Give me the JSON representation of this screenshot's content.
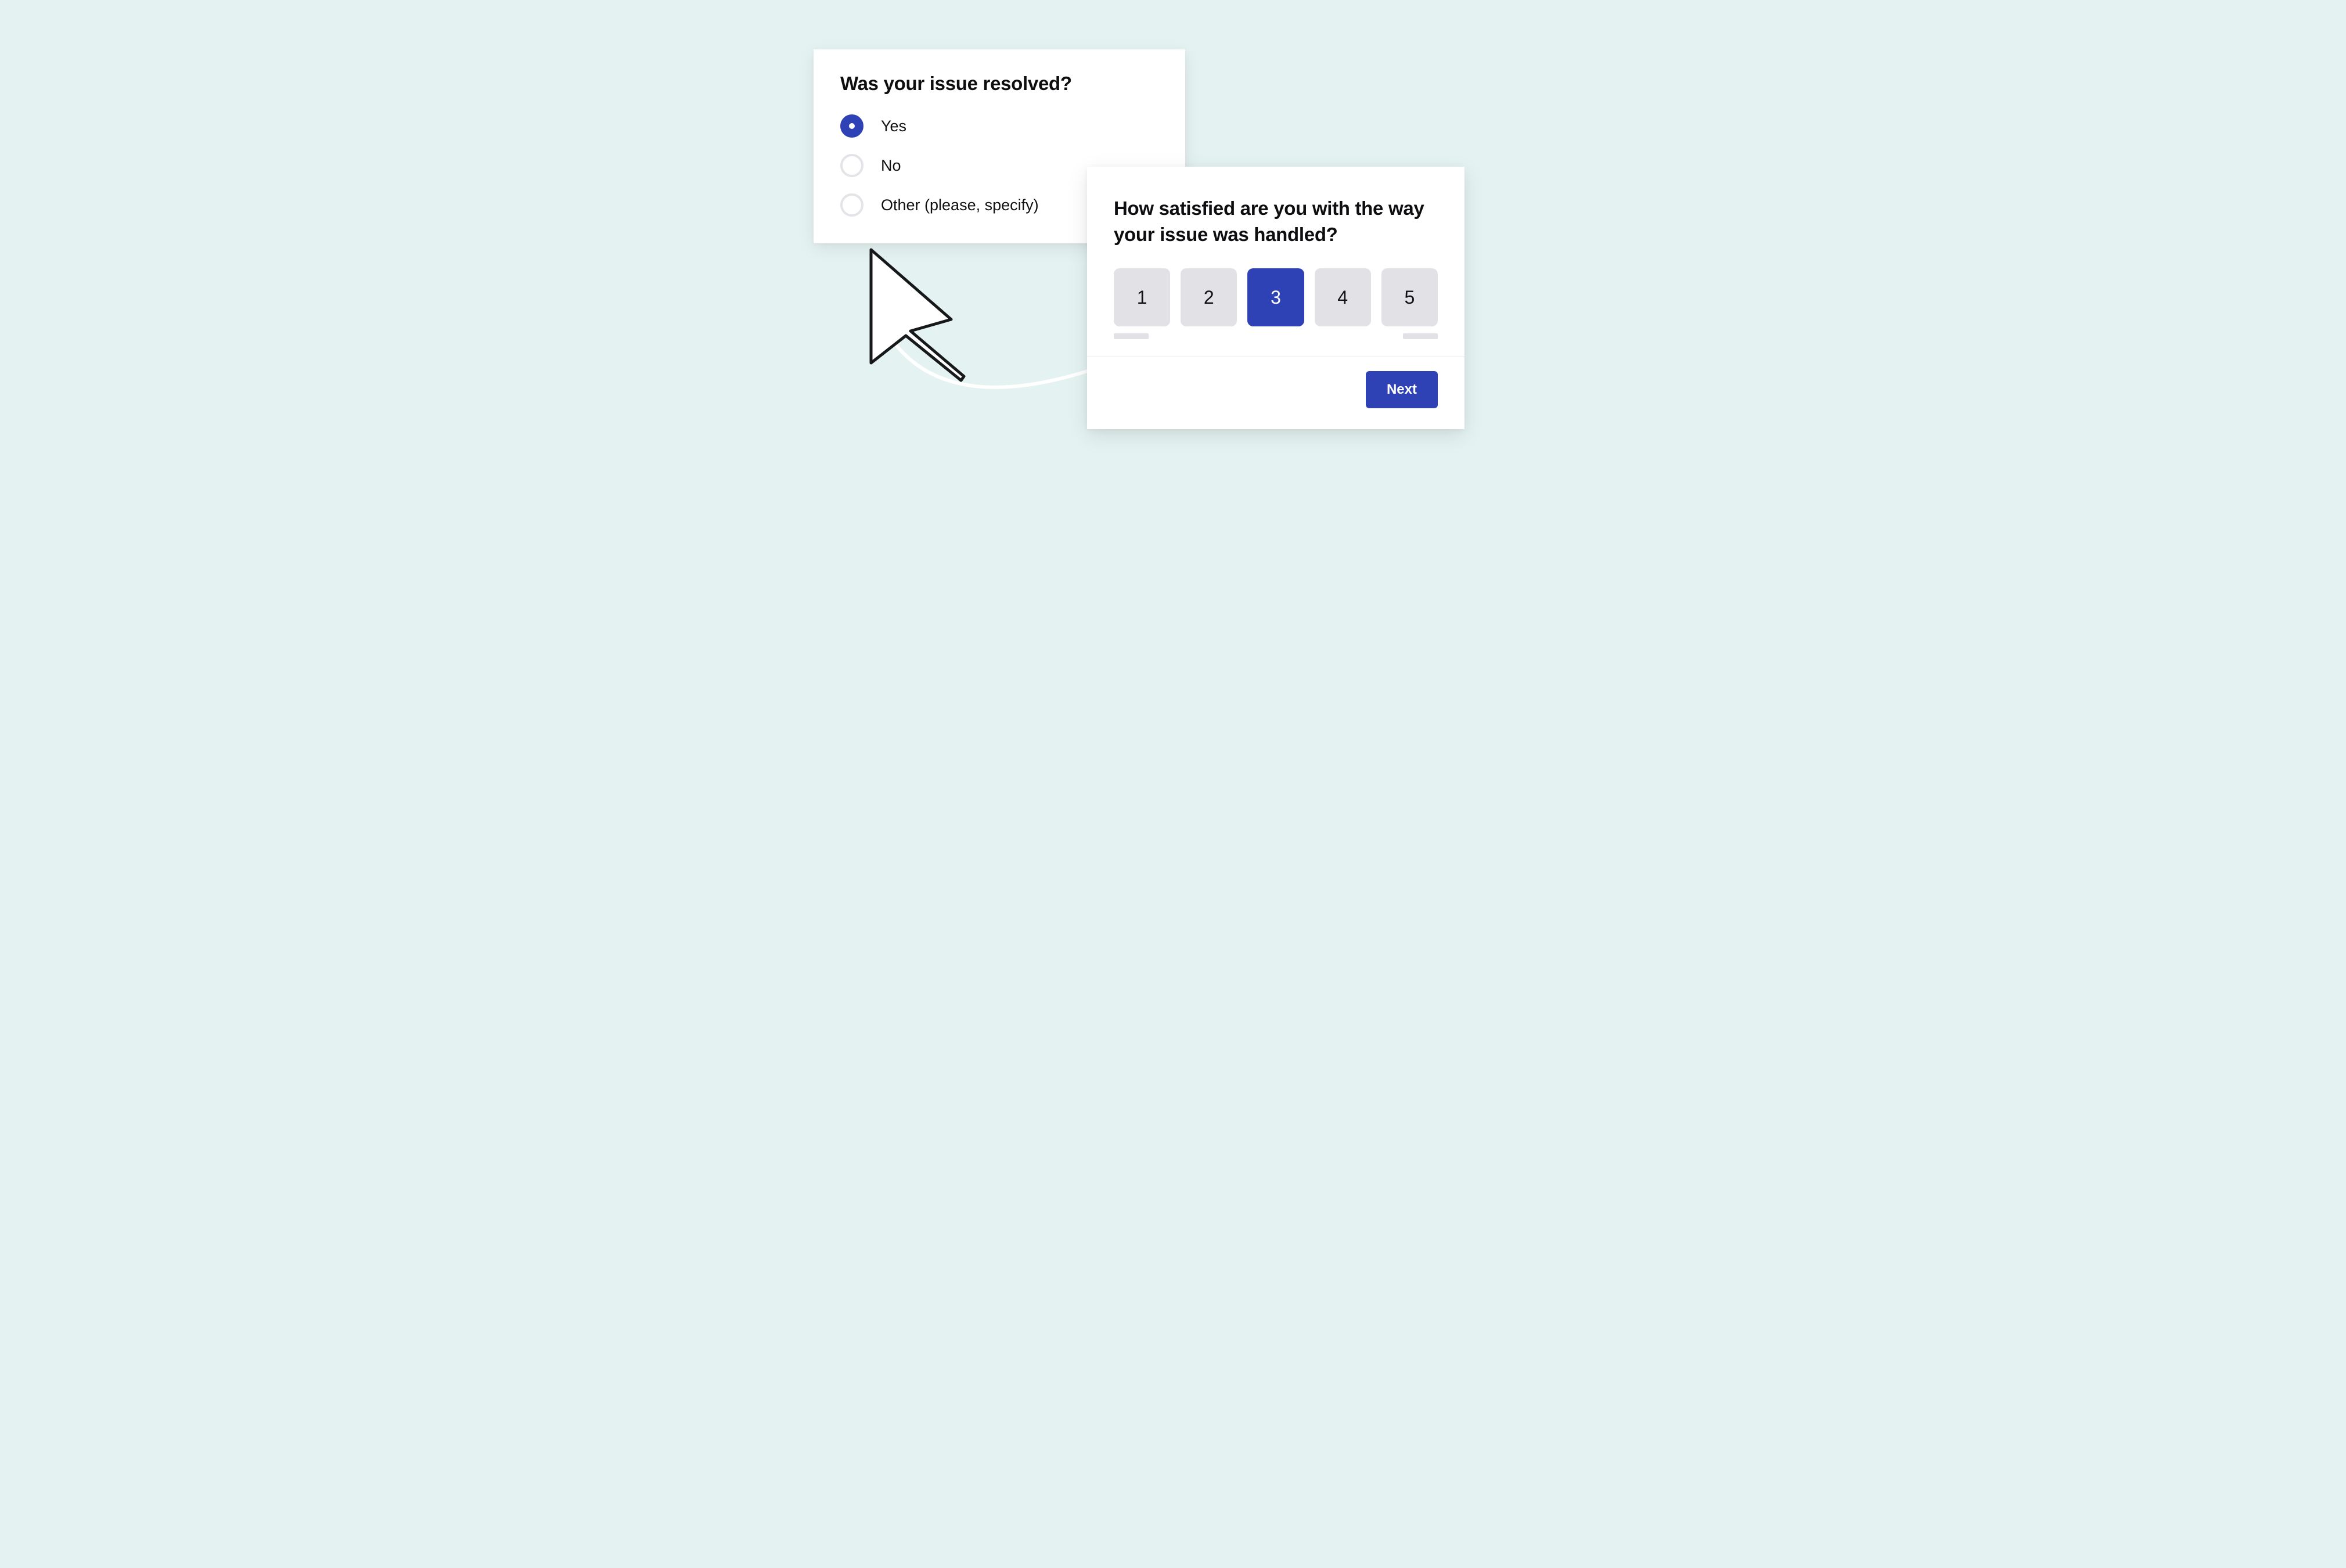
{
  "card1": {
    "title": "Was your issue resolved?",
    "options": [
      {
        "label": "Yes",
        "selected": true
      },
      {
        "label": "No",
        "selected": false
      },
      {
        "label": "Other (please, specify)",
        "selected": false
      }
    ]
  },
  "card2": {
    "title": "How satisfied are you with the way your issue was handled?",
    "ratings": [
      {
        "value": "1",
        "selected": false
      },
      {
        "value": "2",
        "selected": false
      },
      {
        "value": "3",
        "selected": true
      },
      {
        "value": "4",
        "selected": false
      },
      {
        "value": "5",
        "selected": false
      }
    ],
    "next_label": "Next"
  },
  "colors": {
    "primary": "#2f42b5",
    "bg": "#e4f2f1",
    "tile": "#e1e1e6"
  }
}
